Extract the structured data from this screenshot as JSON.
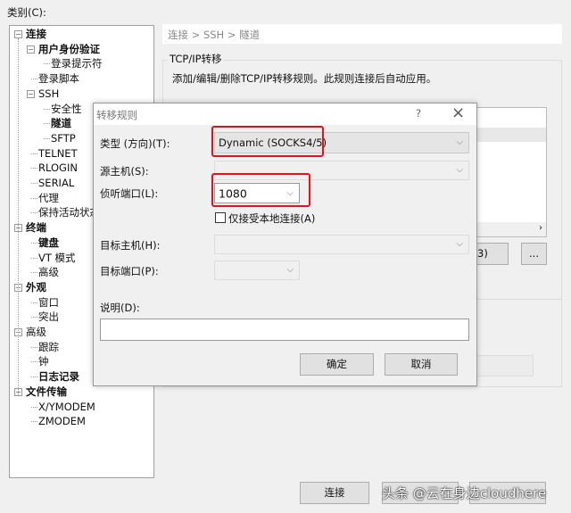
{
  "category_label": "类别(C):",
  "tree": [
    {
      "label": "连接",
      "level": 0,
      "bold": true,
      "expander": true
    },
    {
      "label": "用户身份验证",
      "level": 1,
      "bold": true,
      "expander": true
    },
    {
      "label": "登录提示符",
      "level": 2
    },
    {
      "label": "登录脚本",
      "level": 1
    },
    {
      "label": "SSH",
      "level": 1,
      "expander": true
    },
    {
      "label": "安全性",
      "level": 2
    },
    {
      "label": "隧道",
      "level": 2,
      "bold": true,
      "selected": true
    },
    {
      "label": "SFTP",
      "level": 2
    },
    {
      "label": "TELNET",
      "level": 1
    },
    {
      "label": "RLOGIN",
      "level": 1
    },
    {
      "label": "SERIAL",
      "level": 1
    },
    {
      "label": "代理",
      "level": 1
    },
    {
      "label": "保持活动状态",
      "level": 1
    },
    {
      "label": "终端",
      "level": 0,
      "bold": true,
      "expander": true
    },
    {
      "label": "键盘",
      "level": 1,
      "bold": true
    },
    {
      "label": "VT 模式",
      "level": 1
    },
    {
      "label": "高级",
      "level": 1
    },
    {
      "label": "外观",
      "level": 0,
      "bold": true,
      "expander": true
    },
    {
      "label": "窗口",
      "level": 1
    },
    {
      "label": "突出",
      "level": 1
    },
    {
      "label": "高级",
      "level": 0,
      "expander": true
    },
    {
      "label": "跟踪",
      "level": 1
    },
    {
      "label": "钟",
      "level": 1
    },
    {
      "label": "日志记录",
      "level": 1,
      "bold": true
    },
    {
      "label": "文件传输",
      "level": 0,
      "bold": true,
      "expander": true
    },
    {
      "label": "X/YMODEM",
      "level": 1
    },
    {
      "label": "ZMODEM",
      "level": 1
    }
  ],
  "breadcrumb": "连接 > SSH > 隧道",
  "group_title": "TCP/IP转移",
  "group_desc": "添加/编辑/删除TCP/IP转移规则。此规则连接后自动应用。",
  "side_buttons": {
    "remove_partial": "3)",
    "more": "..."
  },
  "dialog": {
    "title": "转移规则",
    "help": "?",
    "close": "×",
    "type_label": "类型 (方向)(T):",
    "type_value": "Dynamic (SOCKS4/5)",
    "source_label": "源主机(S):",
    "listen_label": "侦听端口(L):",
    "listen_value": "1080",
    "local_only_label": "仅接受本地连接(A)",
    "local_only_checked": false,
    "target_host_label": "目标主机(H):",
    "target_port_label": "目标端口(P):",
    "desc_label": "说明(D):",
    "desc_value": "",
    "ok": "确定",
    "cancel": "取消"
  },
  "footer": {
    "connect": "连接"
  },
  "watermark": "头条 @云在身边cloudhere",
  "colors": {
    "highlight": "#e8111a"
  }
}
